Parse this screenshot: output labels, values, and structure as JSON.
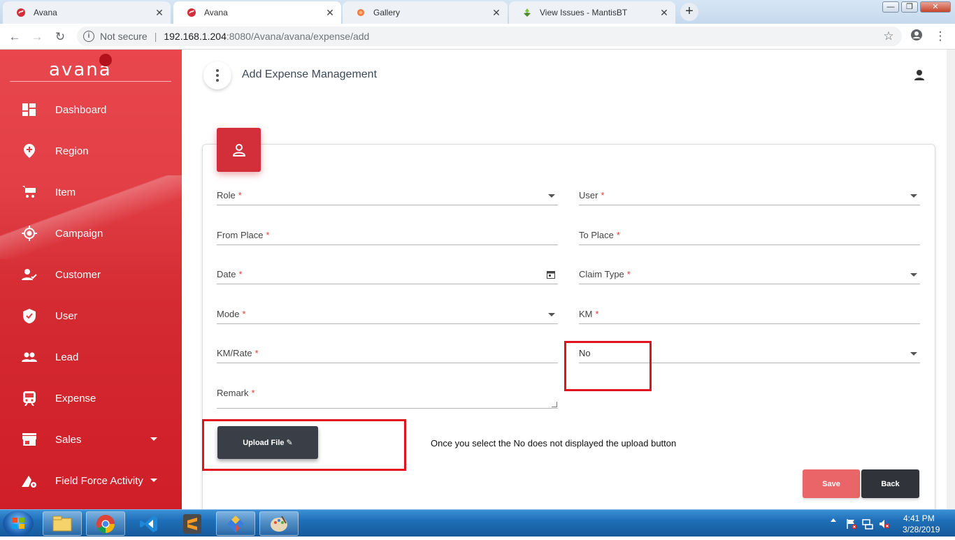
{
  "browser": {
    "tabs": [
      {
        "label": "Avana",
        "icon": "avana-favicon-icon",
        "active": false
      },
      {
        "label": "Avana",
        "icon": "avana-favicon-icon",
        "active": true
      },
      {
        "label": "Gallery",
        "icon": "gallery-favicon-icon",
        "active": false
      },
      {
        "label": "View Issues - MantisBT",
        "icon": "mantis-favicon-icon",
        "active": false
      }
    ],
    "security_label": "Not secure",
    "url_host": "192.168.1.204",
    "url_path": ":8080/Avana/avana/expense/add"
  },
  "sidebar": {
    "logo_text": "avana",
    "items": [
      {
        "label": "Dashboard",
        "icon": "dashboard-icon"
      },
      {
        "label": "Region",
        "icon": "location-pin-icon"
      },
      {
        "label": "Item",
        "icon": "cart-icon"
      },
      {
        "label": "Campaign",
        "icon": "target-icon"
      },
      {
        "label": "Customer",
        "icon": "customer-icon"
      },
      {
        "label": "User",
        "icon": "shield-check-icon"
      },
      {
        "label": "Lead",
        "icon": "group-icon"
      },
      {
        "label": "Expense",
        "icon": "train-icon"
      },
      {
        "label": "Sales",
        "icon": "store-icon",
        "expandable": true
      },
      {
        "label": "Field Force Activity",
        "icon": "field-settings-icon",
        "expandable": true
      }
    ]
  },
  "header": {
    "title": "Add Expense Management"
  },
  "form": {
    "role_label": "Role",
    "user_label": "User",
    "from_place_label": "From Place",
    "to_place_label": "To Place",
    "date_label": "Date",
    "claim_type_label": "Claim Type",
    "mode_label": "Mode",
    "km_label": "KM",
    "km_rate_label": "KM/Rate",
    "bill_select_value": "No",
    "remark_label": "Remark",
    "required_mark": "*",
    "upload_label": "Upload File ✎",
    "note_text": "Once you select the  No does not displayed the upload  button",
    "save_label": "Save",
    "back_label": "Back"
  },
  "taskbar": {
    "time": "4:41 PM",
    "date": "3/28/2019"
  },
  "colors": {
    "brand_red": "#d32f3a",
    "save_button": "#e96567",
    "back_button": "#30343a",
    "annotation_red": "#e0141c"
  }
}
